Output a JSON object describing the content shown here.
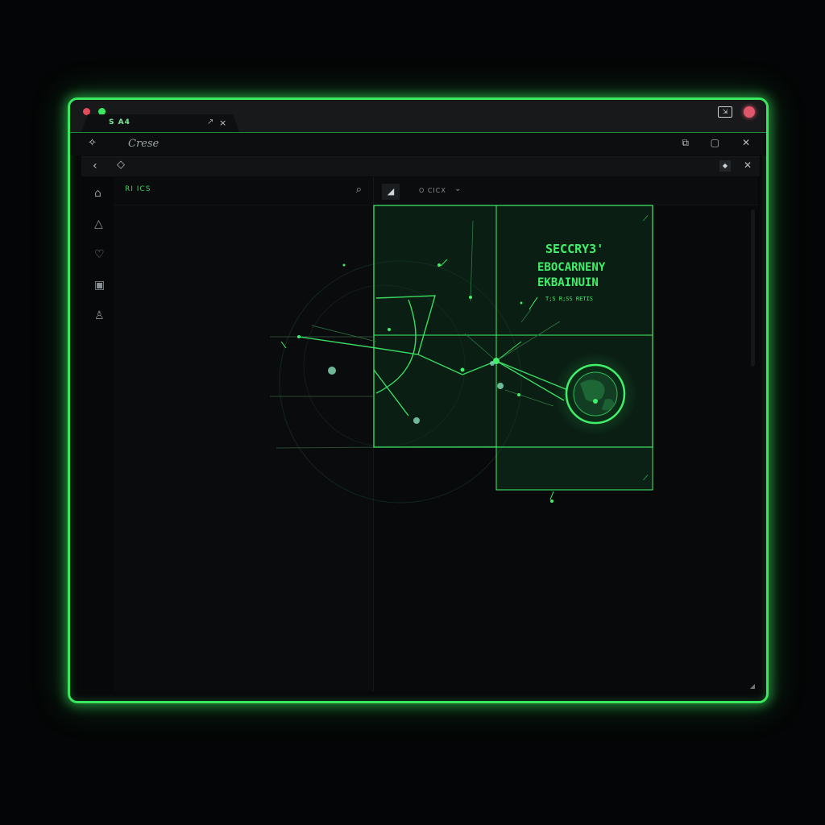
{
  "titlebar": {
    "tab_label": "S A4",
    "tab_close": "×",
    "tab_pin": "↗"
  },
  "toolbar": {
    "label": "Crese"
  },
  "left_pane": {
    "header_label": "RI ICS"
  },
  "right_pane": {
    "header_label": "O CICX"
  },
  "overlay": {
    "title_lines": [
      "SECCRY3'",
      "EBOCARNENY",
      "EKBAINUIN"
    ],
    "subtitle": "T;S R;SS RETIS"
  },
  "colors": {
    "accent": "#39e85c",
    "window_bg": "#08090a",
    "close_dot": "#e24b5b"
  }
}
